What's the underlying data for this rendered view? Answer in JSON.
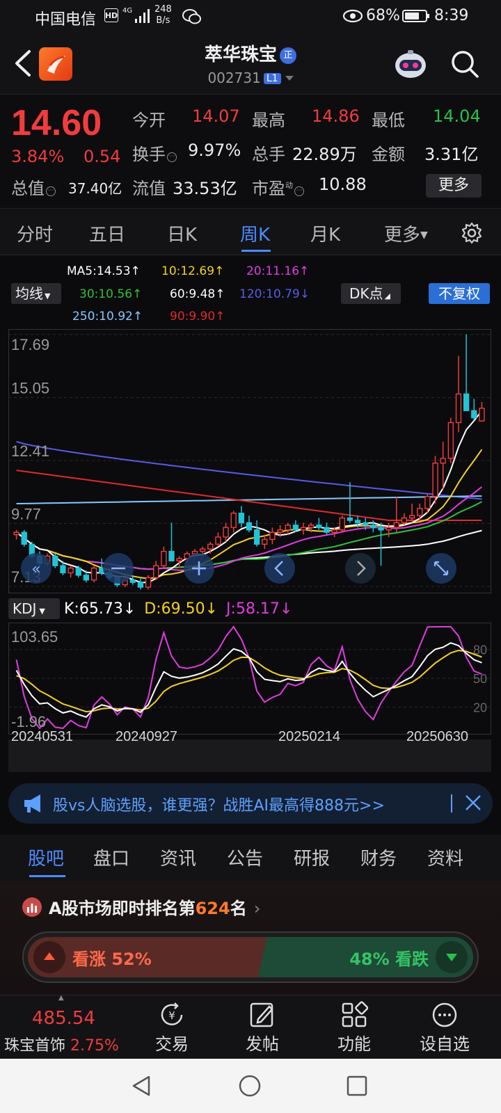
{
  "status": {
    "carrier": "中国电信",
    "hd": "HD",
    "net": "4G",
    "speed_value": "248",
    "speed_unit": "B/s",
    "battery": "68%",
    "time": "8:39"
  },
  "header": {
    "name": "萃华珠宝",
    "badge": "正",
    "code": "002731",
    "level": "L1"
  },
  "quote": {
    "price": "14.60",
    "pct": "3.84%",
    "change": "0.54",
    "open_label": "今开",
    "open": "14.07",
    "high_label": "最高",
    "high": "14.86",
    "low_label": "最低",
    "low": "14.04",
    "turnover_label": "换手",
    "turnover": "9.97%",
    "volume_label": "总手",
    "volume": "22.89万",
    "amount_label": "金额",
    "amount": "3.31亿",
    "mktcap_label": "总值",
    "mktcap": "37.40亿",
    "float_label": "流值",
    "float": "33.53亿",
    "pe_label": "市盈",
    "pe_sup": "动",
    "pe": "10.88",
    "more": "更多"
  },
  "ktabs": [
    "分时",
    "五日",
    "日K",
    "周K",
    "月K",
    "更多"
  ],
  "ma": {
    "ma5": "MA5:14.53",
    "ma10": "10:12.69",
    "ma20": "20:11.16",
    "ma30": "30:10.56",
    "ma60": "60:9.48",
    "ma120": "120:10.79",
    "ma250": "250:10.92",
    "ma90": "90:9.90",
    "up": "↑",
    "down": "↓",
    "junxian": "均线",
    "dk": "DK点",
    "nofq": "不复权"
  },
  "colors": {
    "up": "#f23c3c",
    "down": "#27c24c",
    "accent": "#4c8cff",
    "ma5": "#ffffff",
    "ma10": "#f5d020",
    "ma20": "#e03ce0",
    "ma30": "#2fc23a",
    "ma60": "#ffffff",
    "ma120": "#5a5ae8",
    "ma250": "#86c8ff",
    "ma90": "#e02a2a"
  },
  "chart_data": [
    {
      "type": "candlestick",
      "title": "",
      "yticks": [
        "17.69",
        "15.05",
        "12.41",
        "9.77",
        "7.13"
      ],
      "ylim": [
        7.13,
        17.69
      ],
      "grid": true,
      "candles": [
        [
          9.3,
          9.5,
          9.1,
          9.4
        ],
        [
          9.4,
          9.5,
          8.8,
          8.9
        ],
        [
          8.9,
          9.0,
          8.3,
          8.4
        ],
        [
          8.4,
          8.6,
          8.0,
          8.1
        ],
        [
          8.1,
          8.5,
          8.0,
          8.4
        ],
        [
          8.4,
          8.5,
          7.9,
          8.0
        ],
        [
          8.0,
          8.2,
          7.6,
          7.7
        ],
        [
          7.7,
          8.0,
          7.5,
          7.9
        ],
        [
          7.9,
          8.0,
          7.5,
          7.6
        ],
        [
          7.6,
          7.8,
          7.3,
          7.4
        ],
        [
          7.4,
          8.0,
          7.3,
          7.9
        ],
        [
          7.9,
          8.3,
          7.6,
          7.7
        ],
        [
          7.7,
          7.9,
          7.4,
          7.5
        ],
        [
          7.5,
          7.6,
          7.1,
          7.2
        ],
        [
          7.2,
          7.5,
          7.1,
          7.4
        ],
        [
          7.4,
          7.6,
          7.2,
          7.3
        ],
        [
          7.3,
          7.5,
          7.0,
          7.1
        ],
        [
          7.1,
          7.6,
          7.0,
          7.5
        ],
        [
          7.5,
          8.2,
          7.4,
          8.0
        ],
        [
          8.0,
          8.8,
          7.9,
          8.6
        ],
        [
          8.6,
          9.8,
          8.2,
          8.2
        ],
        [
          8.2,
          8.4,
          7.9,
          8.3
        ],
        [
          8.3,
          8.6,
          8.1,
          8.5
        ],
        [
          8.5,
          8.7,
          8.3,
          8.6
        ],
        [
          8.6,
          8.8,
          8.4,
          8.7
        ],
        [
          8.7,
          9.0,
          8.5,
          8.9
        ],
        [
          8.9,
          9.4,
          8.8,
          9.2
        ],
        [
          9.2,
          9.8,
          9.0,
          9.6
        ],
        [
          9.6,
          10.3,
          9.4,
          10.2
        ],
        [
          10.2,
          10.5,
          9.6,
          9.8
        ],
        [
          9.8,
          10.1,
          9.4,
          9.5
        ],
        [
          9.5,
          9.9,
          8.8,
          8.9
        ],
        [
          8.9,
          9.3,
          8.7,
          9.1
        ],
        [
          9.1,
          9.6,
          8.9,
          9.4
        ],
        [
          9.4,
          9.7,
          9.2,
          9.5
        ],
        [
          9.5,
          9.8,
          9.3,
          9.7
        ],
        [
          9.7,
          9.9,
          9.4,
          9.5
        ],
        [
          9.5,
          9.8,
          9.3,
          9.6
        ],
        [
          9.6,
          9.8,
          9.4,
          9.7
        ],
        [
          9.7,
          10.0,
          9.5,
          9.6
        ],
        [
          9.6,
          9.8,
          9.3,
          9.4
        ],
        [
          9.4,
          9.6,
          9.2,
          9.5
        ],
        [
          9.5,
          10.1,
          9.4,
          10.0
        ],
        [
          10.0,
          11.5,
          9.8,
          9.9
        ],
        [
          9.9,
          10.1,
          9.6,
          9.8
        ],
        [
          9.8,
          10.0,
          9.5,
          9.7
        ],
        [
          9.7,
          9.9,
          9.4,
          9.6
        ],
        [
          9.6,
          9.8,
          8.0,
          9.5
        ],
        [
          9.5,
          9.8,
          9.2,
          9.6
        ],
        [
          9.6,
          10.9,
          9.4,
          9.8
        ],
        [
          9.8,
          10.2,
          9.7,
          10.0
        ],
        [
          10.0,
          10.6,
          9.8,
          10.1
        ],
        [
          10.1,
          10.6,
          9.9,
          10.4
        ],
        [
          10.4,
          11.0,
          10.2,
          10.9
        ],
        [
          10.9,
          12.6,
          10.6,
          12.3
        ],
        [
          12.3,
          13.2,
          11.2,
          12.5
        ],
        [
          12.5,
          14.2,
          12.3,
          14.0
        ],
        [
          14.0,
          16.8,
          13.6,
          15.2
        ],
        [
          15.2,
          17.7,
          14.6,
          14.5
        ],
        [
          14.5,
          15.0,
          14.1,
          14.2
        ],
        [
          14.07,
          14.86,
          14.04,
          14.6
        ]
      ]
    },
    {
      "type": "line",
      "title": "KDJ",
      "series_labels": {
        "k": "K:65.73",
        "d": "D:69.50",
        "j": "J:58.17"
      },
      "yticks": [
        "103.65",
        "-1.96"
      ],
      "ylim": [
        -1.96,
        103.65
      ],
      "ref_levels": [
        "80",
        "50",
        "20"
      ],
      "x_labels": [
        "20240531",
        "20240927",
        "20250214",
        "20250630"
      ]
    }
  ],
  "ad": {
    "text": "股vs人脑选股，谁更强？战胜AI最高得888元>>"
  },
  "section_tabs": [
    "股吧",
    "盘口",
    "资讯",
    "公告",
    "研报",
    "财务",
    "资料"
  ],
  "rank": {
    "prefix": "A股市场即时排名第",
    "num": "624",
    "suffix": "名",
    "arrow": "›"
  },
  "vote": {
    "up": "看涨 52%",
    "down": "48% 看跌",
    "up_ratio": 0.52
  },
  "bottom": {
    "index_value": "485.54",
    "index_name": "珠宝首饰",
    "index_pct": "2.75%",
    "items": [
      "交易",
      "发帖",
      "功能",
      "设自选"
    ]
  }
}
